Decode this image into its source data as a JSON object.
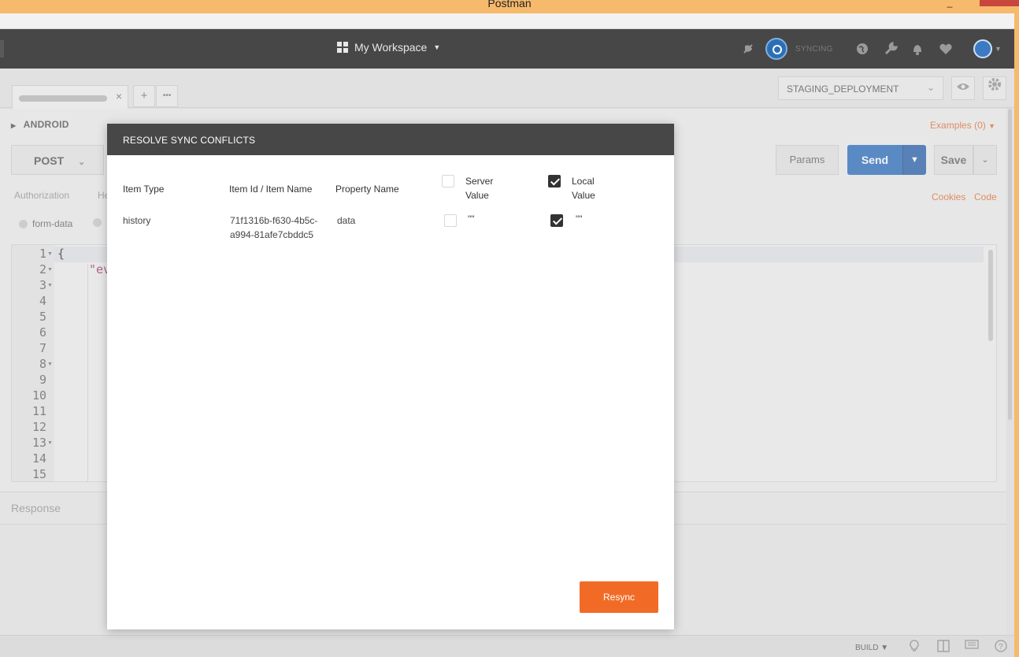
{
  "window": {
    "title": "Postman",
    "minimize": "_",
    "close": "×"
  },
  "header": {
    "workspace_label": "My Workspace",
    "sync_status": "SYNCING",
    "icons": [
      "satellite-icon",
      "sync-icon",
      "globe-icon",
      "wrench-icon",
      "bell-icon",
      "heart-icon",
      "avatar"
    ]
  },
  "tabs": {
    "close_glyph": "×",
    "add_glyph": "+",
    "more_glyph": "•••"
  },
  "environment": {
    "selected": "STAGING_DEPLOYMENT"
  },
  "request": {
    "name": "ANDROID",
    "examples_label": "Examples (0)",
    "method": "POST",
    "params_label": "Params",
    "send_label": "Send",
    "save_label": "Save",
    "subtabs": {
      "authorization": "Authorization",
      "headers": "He"
    },
    "cookies_label": "Cookies",
    "code_label": "Code",
    "body_mode": "form-data",
    "editor": {
      "line_numbers": [
        "1",
        "2",
        "3",
        "4",
        "5",
        "6",
        "7",
        "8",
        "9",
        "10",
        "11",
        "12",
        "13",
        "14",
        "15"
      ],
      "line1": "{",
      "line2": "\"ev"
    }
  },
  "response": {
    "label": "Response"
  },
  "statusbar": {
    "build_label": "BUILD ▼"
  },
  "modal": {
    "title": "RESOLVE SYNC CONFLICTS",
    "columns": {
      "item_type": "Item Type",
      "item_id": "Item Id / Item Name",
      "property": "Property Name",
      "server_line1": "Server",
      "server_line2": "Value",
      "local_line1": "Local",
      "local_line2": "Value"
    },
    "header_checkboxes": {
      "server_checked": false,
      "local_checked": true
    },
    "rows": [
      {
        "item_type": "history",
        "item_id_line1": "71f1316b-f630-4b5c-",
        "item_id_line2": "a994-81afe7cbddc5",
        "property": "data",
        "server_value": "\"\"",
        "local_value": "\"\"",
        "server_checked": false,
        "local_checked": true
      }
    ],
    "resync_label": "Resync"
  },
  "colors": {
    "accent_orange": "#f26b26",
    "send_blue": "#2d6fc0",
    "header_dark": "#474747",
    "titlebar": "#f7b96c"
  }
}
